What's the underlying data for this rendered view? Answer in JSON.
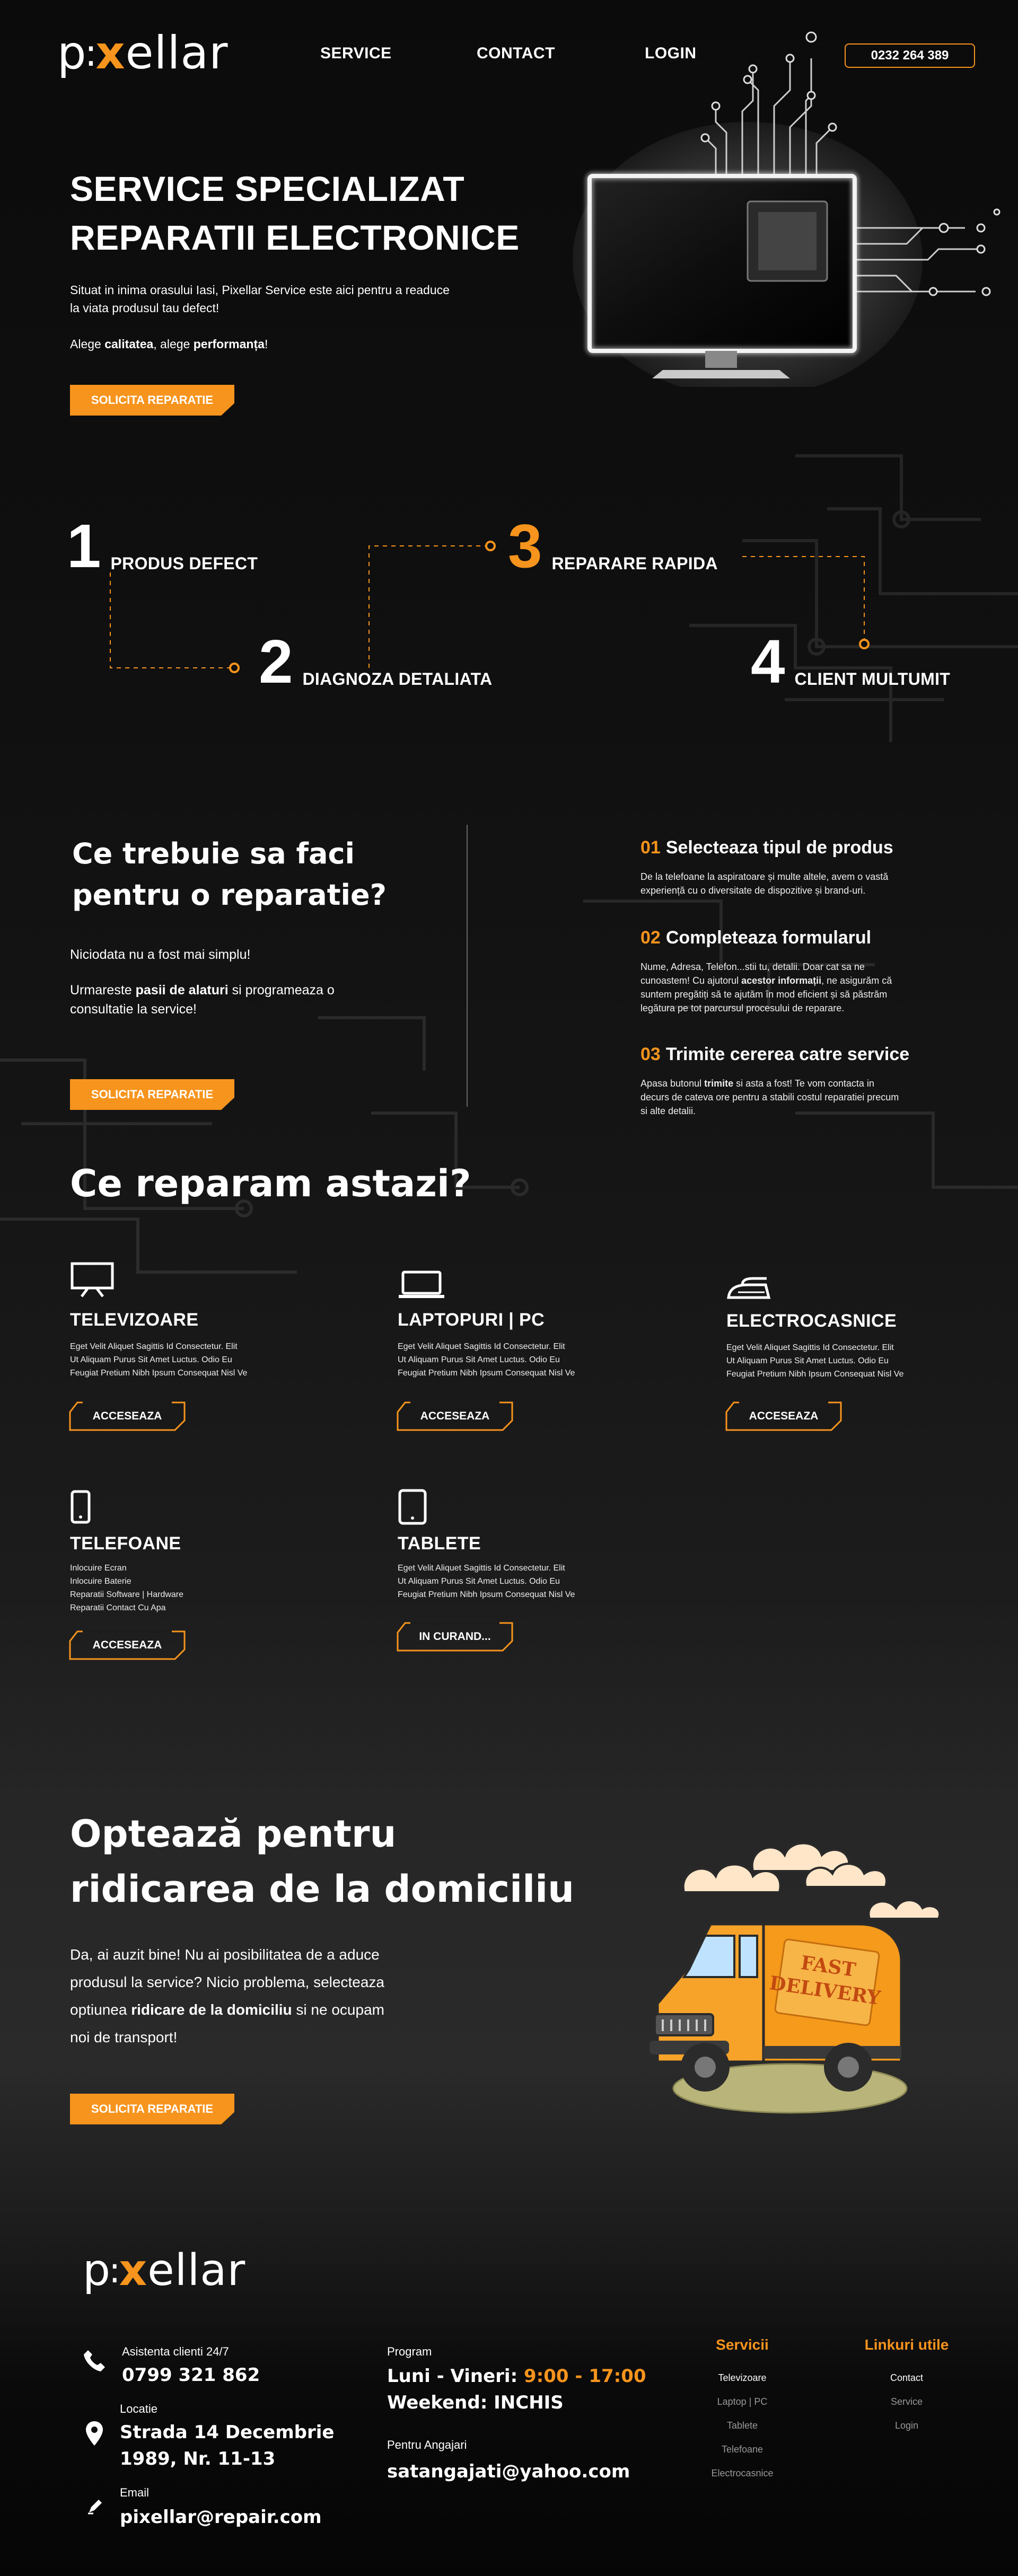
{
  "header": {
    "logo": {
      "prefix": "p",
      "mark": "x",
      "suffix": "ellar",
      "dot": ":"
    },
    "nav": [
      "SERVICE",
      "CONTACT",
      "LOGIN"
    ],
    "phone": "0232 264 389"
  },
  "hero": {
    "title_line1": "SERVICE SPECIALIZAT",
    "title_line2": "REPARATII ELECTRONICE",
    "text1": "Situat in inima orasului Iasi, Pixellar Service este aici pentru a readuce la viata produsul tau defect!",
    "text2_a": "Alege ",
    "text2_b": "calitatea",
    "text2_c": ", alege ",
    "text2_d": "performanța",
    "text2_e": "!",
    "cta": "SOLICITA REPARATIE"
  },
  "steps": [
    {
      "num": "1",
      "label": "PRODUS DEFECT"
    },
    {
      "num": "2",
      "label": "DIAGNOZA DETALIATA"
    },
    {
      "num": "3",
      "label": "REPARARE RAPIDA"
    },
    {
      "num": "4",
      "label": "CLIENT MULTUMIT"
    }
  ],
  "howto": {
    "title_line1": "Ce trebuie sa faci",
    "title_line2": "pentru o reparatie?",
    "text1": "Niciodata nu a fost mai simplu!",
    "text2_a": "Urmareste ",
    "text2_b": "pasii de alaturi",
    "text2_c": " si programeaza o consultatie la service!",
    "cta": "SOLICITA REPARATIE",
    "items": [
      {
        "num": "01",
        "title": "Selecteaza tipul de produs",
        "text": "De la telefoane la aspiratoare și multe altele, avem o vastă experiență cu o diversitate de dispozitive și brand-uri."
      },
      {
        "num": "02",
        "title": "Completeaza formularul",
        "text_a": "Nume, Adresa, Telefon...stii tu, detalii. Doar cat sa ne cunoastem! Cu ajutorul ",
        "text_b": "acestor informații",
        "text_c": ", ne asigurăm că suntem pregătiți să te ajutăm în mod eficient și să păstrăm legătura pe tot parcursul procesului de reparare."
      },
      {
        "num": "03",
        "title": "Trimite cererea catre service",
        "text_a": "Apasa butonul ",
        "text_b": "trimite",
        "text_c": " si asta a fost! Te vom contacta in decurs de cateva ore pentru a stabili costul reparatiei precum si alte detalii."
      }
    ]
  },
  "repair": {
    "title": "Ce reparam astazi?",
    "cards": [
      {
        "icon": "tv-icon",
        "title": "TELEVIZOARE",
        "lines": [
          "Eget Velit Aliquet Sagittis Id Consectetur. Elit",
          "Ut Aliquam Purus Sit Amet Luctus. Odio Eu",
          "Feugiat Pretium Nibh Ipsum Consequat Nisl Ve"
        ],
        "button": "ACCESEAZA"
      },
      {
        "icon": "laptop-icon",
        "title": "LAPTOPURI | PC",
        "lines": [
          "Eget Velit Aliquet Sagittis Id Consectetur. Elit",
          "Ut Aliquam Purus Sit Amet Luctus. Odio Eu",
          "Feugiat Pretium Nibh Ipsum Consequat Nisl Ve"
        ],
        "button": "ACCESEAZA"
      },
      {
        "icon": "iron-icon",
        "title": "ELECTROCASNICE",
        "lines": [
          "Eget Velit Aliquet Sagittis Id Consectetur. Elit",
          "Ut Aliquam Purus Sit Amet Luctus. Odio Eu",
          "Feugiat Pretium Nibh Ipsum Consequat Nisl Ve"
        ],
        "button": "ACCESEAZA"
      },
      {
        "icon": "phone-icon",
        "title": "TELEFOANE",
        "lines": [
          "Inlocuire Ecran",
          "Inlocuire Baterie",
          "Reparatii Software | Hardware",
          "Reparatii Contact Cu Apa"
        ],
        "button": "ACCESEAZA"
      },
      {
        "icon": "tablet-icon",
        "title": "TABLETE",
        "lines": [
          "Eget Velit Aliquet Sagittis Id Consectetur. Elit",
          "Ut Aliquam Purus Sit Amet Luctus. Odio Eu",
          "Feugiat Pretium Nibh Ipsum Consequat Nisl Ve"
        ],
        "button": "IN CURAND..."
      }
    ]
  },
  "pickup": {
    "title_line1": "Optează pentru",
    "title_line2": "ridicarea de la domiciliu",
    "text_a": "Da, ai auzit bine! Nu ai posibilitatea de a aduce produsul la service? Nicio problema, selecteaza optiunea ",
    "text_b": "ridicare de la domiciliu",
    "text_c": " si ne ocupam noi de transport!",
    "cta": "SOLICITA REPARATIE",
    "van_sign_line1": "FAST",
    "van_sign_line2": "DELIVERY"
  },
  "footer": {
    "support_label": "Asistenta clienti 24/7",
    "support_phone": "0799 321 862",
    "location_label": "Locatie",
    "location_line1": "Strada 14 Decembrie",
    "location_line2": "1989, Nr. 11-13",
    "email_label": "Email",
    "email": "pixellar@repair.com",
    "program_label": "Program",
    "weekdays_a": "Luni - Vineri: ",
    "weekdays_b": "9:00 - 17:00",
    "weekend": "Weekend: INCHIS",
    "jobs_label": "Pentru Angajari",
    "jobs_email": "satangajati@yahoo.com",
    "services_head": "Servicii",
    "services": [
      "Televizoare",
      "Laptop | PC",
      "Tablete",
      "Telefoane",
      "Electrocasnice"
    ],
    "links_head": "Linkuri utile",
    "links": [
      "Contact",
      "Service",
      "Login"
    ]
  },
  "colors": {
    "accent": "#f7941d",
    "background": "#0e0e0e"
  }
}
